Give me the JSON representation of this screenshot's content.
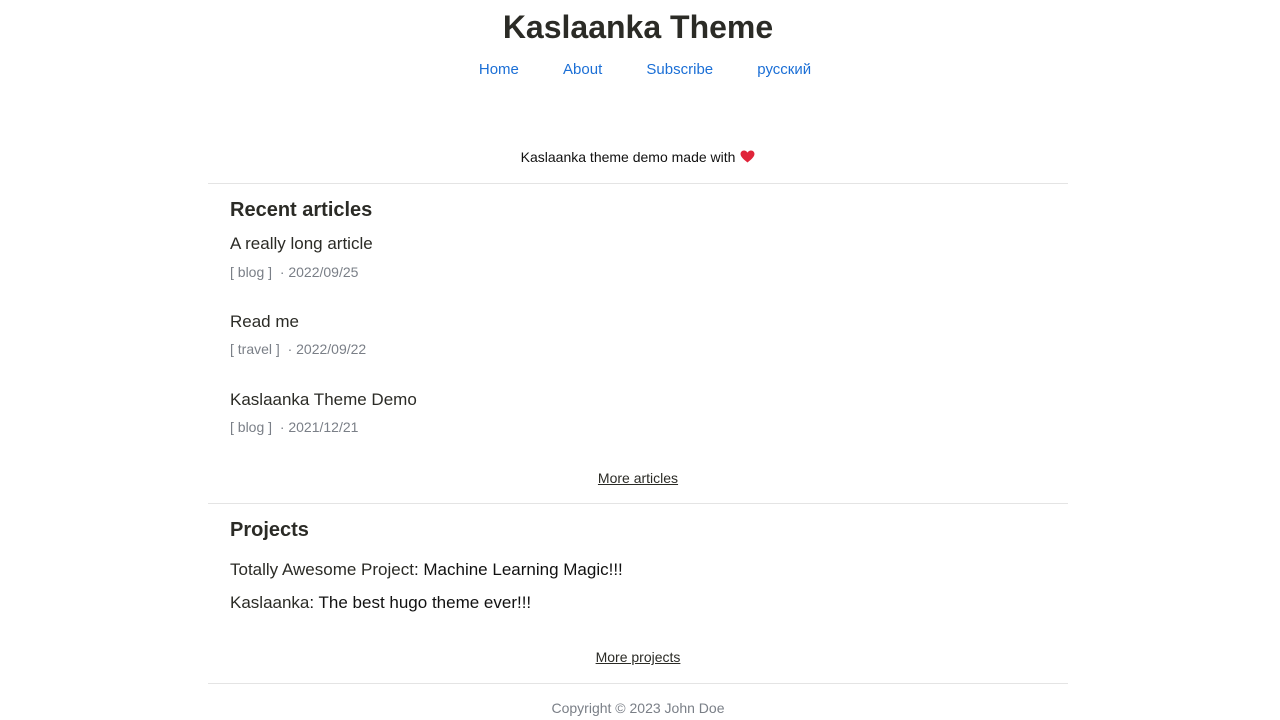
{
  "site": {
    "title": "Kaslaanka Theme",
    "accent_color": "#1b6fd6",
    "heart_color": "#e0243a"
  },
  "nav": {
    "items": [
      {
        "label": "Home"
      },
      {
        "label": "About"
      },
      {
        "label": "Subscribe"
      },
      {
        "label": "русский"
      }
    ]
  },
  "tagline": {
    "text": "Kaslaanka theme demo made with",
    "icon": "heart-icon"
  },
  "recent": {
    "heading": "Recent articles",
    "articles": [
      {
        "title": "A really long article",
        "tag": "[ blog ]",
        "date": "· 2022/09/25"
      },
      {
        "title": "Read me",
        "tag": "[ travel ]",
        "date": "· 2022/09/22"
      },
      {
        "title": "Kaslaanka Theme Demo",
        "tag": "[ blog ]",
        "date": "· 2021/12/21"
      }
    ],
    "more_label": "More articles"
  },
  "projects": {
    "heading": "Projects",
    "items": [
      {
        "name": "Totally Awesome Project",
        "description": ": Machine Learning Magic!!!"
      },
      {
        "name": "Kaslaanka",
        "description": ": The best hugo theme ever!!!"
      }
    ],
    "more_label": "More projects"
  },
  "footer": {
    "copyright": "Copyright © 2023 John Doe"
  }
}
